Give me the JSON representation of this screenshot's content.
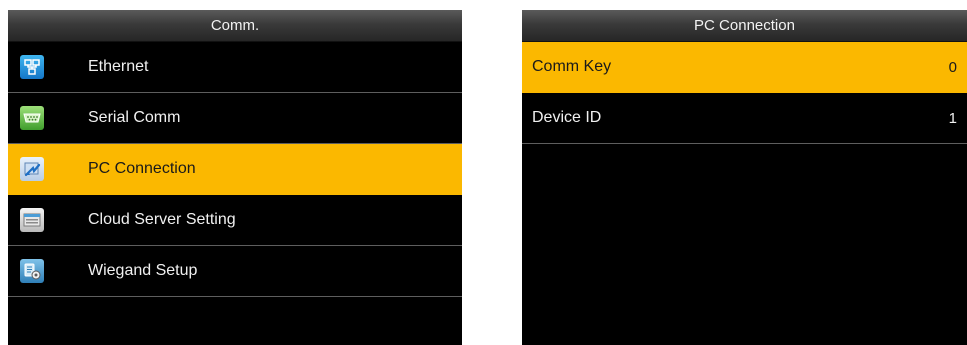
{
  "left_screen": {
    "title": "Comm.",
    "items": [
      {
        "label": "Ethernet",
        "icon": "ethernet-icon",
        "selected": false
      },
      {
        "label": "Serial Comm",
        "icon": "serial-port-icon",
        "selected": false
      },
      {
        "label": "PC Connection",
        "icon": "pc-connection-icon",
        "selected": true
      },
      {
        "label": "Cloud Server Setting",
        "icon": "cloud-server-icon",
        "selected": false
      },
      {
        "label": "Wiegand Setup",
        "icon": "wiegand-icon",
        "selected": false
      }
    ]
  },
  "right_screen": {
    "title": "PC Connection",
    "rows": [
      {
        "label": "Comm Key",
        "value": "0",
        "selected": true
      },
      {
        "label": "Device ID",
        "value": "1",
        "selected": false
      }
    ]
  },
  "colors": {
    "selection": "#fbb800",
    "background": "#000000",
    "divider": "#5e5e5e",
    "text": "#f0f0f0"
  }
}
